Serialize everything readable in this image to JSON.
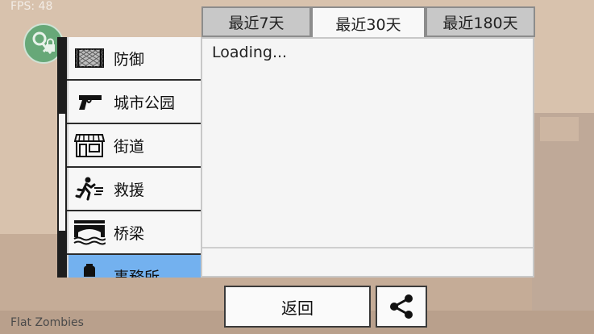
{
  "hud": {
    "fps": "FPS: 48",
    "game_name": "Flat Zombies"
  },
  "tabs": [
    {
      "label": "最近7天",
      "active": false
    },
    {
      "label": "最近30天",
      "active": true
    },
    {
      "label": "最近180天",
      "active": false
    }
  ],
  "categories": [
    {
      "label": "防御",
      "icon": "fence-icon",
      "selected": false
    },
    {
      "label": "城市公园",
      "icon": "pistol-icon",
      "selected": false
    },
    {
      "label": "街道",
      "icon": "shop-icon",
      "selected": false
    },
    {
      "label": "救援",
      "icon": "running-man-icon",
      "selected": false
    },
    {
      "label": "桥梁",
      "icon": "bridge-icon",
      "selected": false
    },
    {
      "label": "事務所",
      "icon": "office-icon",
      "selected": true
    }
  ],
  "content": {
    "status": "Loading..."
  },
  "buttons": {
    "back_label": "返回",
    "share_icon": "share-icon"
  },
  "colors": {
    "selected": "#73b1ef",
    "key_button": "#67a878"
  }
}
